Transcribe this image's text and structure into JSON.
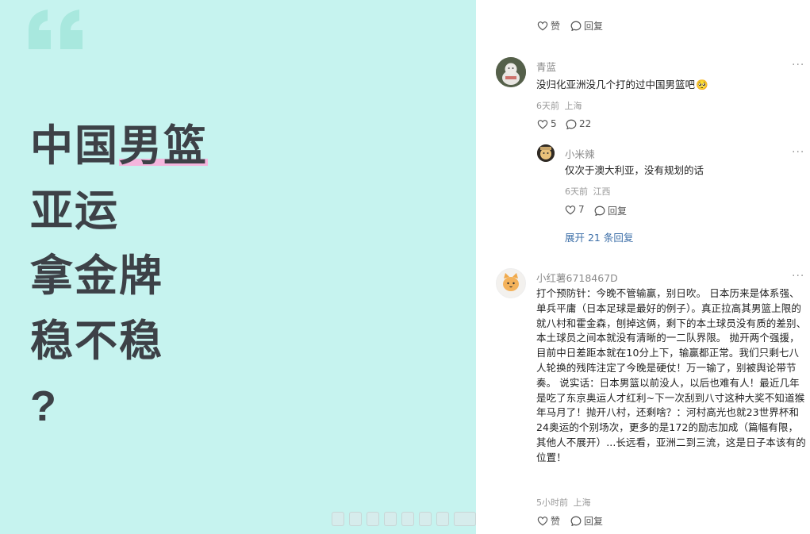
{
  "poster": {
    "headline_lines": [
      "中国",
      "男篮",
      "亚运",
      "拿金牌",
      "稳不稳",
      "?"
    ],
    "highlight_color": "#f4b6dd",
    "background": "#c6f3ef",
    "quote_icon": "quote-mark-icon"
  },
  "comments": {
    "top_actions": {
      "like_label": "赞",
      "reply_label": "回复"
    },
    "thread": [
      {
        "username": "青蓝",
        "text": "没归化亚洲没几个打的过中国男篮吧",
        "emoji": "🥺",
        "time": "6天前",
        "location": "上海",
        "likes": "5",
        "replies": "22",
        "sub_reply": {
          "username": "小米辣",
          "text": "仅次于澳大利亚，没有规划的话",
          "time": "6天前",
          "location": "江西",
          "likes": "7",
          "reply_label": "回复"
        },
        "expand_label": "展开 21 条回复"
      },
      {
        "username": "小红薯6718467D",
        "text": "打个预防针：今晚不管输赢，别日吹。 日本历来是体系强、单兵平庸（日本足球是最好的例子）。真正拉高其男篮上限的就八村和霍金森，刨掉这俩，剩下的本土球员没有质的差别、本土球员之间本就没有清晰的一二队界限。 抛开两个强援，目前中日差距本就在10分上下，输赢都正常。我们只剩七八人轮换的残阵注定了今晚是硬仗！万一输了，别被舆论带节奏。 说实话：日本男篮以前没人，以后也难有人！最近几年是吃了东京奥运人才红利~下一次刮到八寸这种大奖不知道猴年马月了！抛开八村，还剩啥？：河村高光也就23世界杯和24奥运的个别场次，更多的是172的励志加成（篇幅有限，其他人不展开）...长远看，亚洲二到三流，这是日子本该有的位置！",
        "time": "5小时前",
        "location": "上海",
        "like_label": "赞",
        "reply_label": "回复"
      }
    ]
  }
}
